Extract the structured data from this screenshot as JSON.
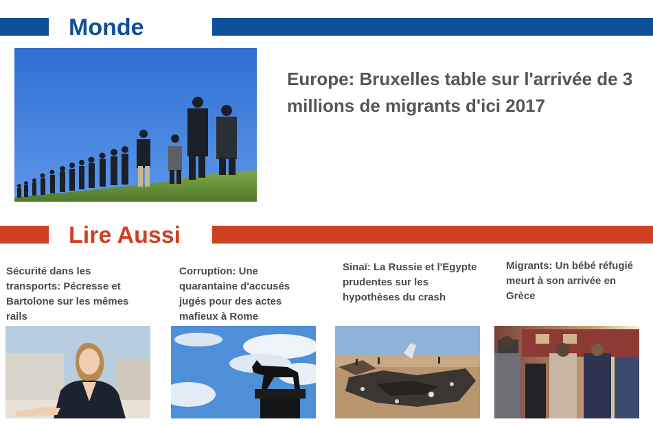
{
  "colors": {
    "monde_blue": "#0d4f98",
    "lire_red": "#d03f23",
    "text_grey": "#555555"
  },
  "monde": {
    "title": "Monde",
    "headline": "Europe: Bruxelles table sur l'arrivée de 3 millions de migrants d'ici 2017",
    "image_icon": "police-migrants-photo"
  },
  "lire_aussi": {
    "title": "Lire Aussi",
    "articles": [
      {
        "title": "Sécurité dans les transports: Pécresse et Bartolone sur les mêmes rails",
        "image_icon": "woman-portrait-photo"
      },
      {
        "title": "Corruption: Une quarantaine d'accusés jugés pour des actes mafieux à Rome",
        "image_icon": "she-wolf-statue-photo"
      },
      {
        "title": "Sinaï: La Russie et l'Egypte prudentes sur les hypothèses du crash",
        "image_icon": "plane-wreckage-photo"
      },
      {
        "title": "Migrants: Un bébé réfugié meurt à son arrivée en Grèce",
        "image_icon": "refugees-train-photo"
      }
    ]
  }
}
